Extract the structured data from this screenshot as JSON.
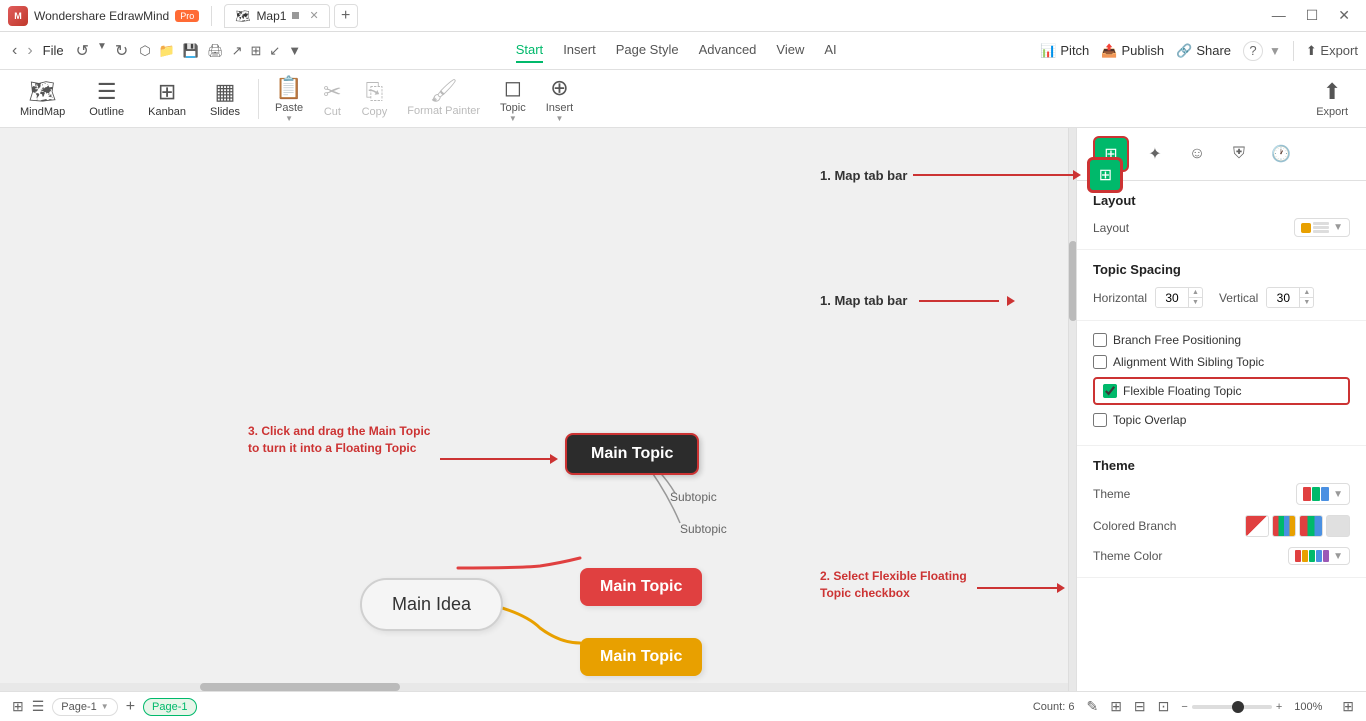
{
  "titlebar": {
    "app_name": "Wondershare EdrawMind",
    "pro_label": "Pro",
    "tab_name": "Map1",
    "tab_icon": "🗺",
    "add_tab": "+",
    "minimize": "—",
    "maximize": "☐",
    "close": "✕"
  },
  "menubar": {
    "back": "‹",
    "forward": "›",
    "file": "File",
    "undo": "↺",
    "redo": "↻",
    "toolbar_icons": [
      "□",
      "□",
      "⊞",
      "🖨",
      "↗",
      "◫",
      "↙"
    ],
    "tabs": [
      {
        "label": "Start",
        "active": true
      },
      {
        "label": "Insert",
        "active": false
      },
      {
        "label": "Page Style",
        "active": false
      },
      {
        "label": "Advanced",
        "active": false
      },
      {
        "label": "View",
        "active": false
      },
      {
        "label": "AI",
        "active": false
      }
    ],
    "pitch": "Pitch",
    "publish": "Publish",
    "share": "Share",
    "help": "?",
    "export": "Export"
  },
  "toolbar": {
    "mindmap": "MindMap",
    "outline": "Outline",
    "kanban": "Kanban",
    "slides": "Slides",
    "paste": "Paste",
    "cut": "Cut",
    "copy": "Copy",
    "format_painter": "Format Painter",
    "topic": "Topic",
    "insert": "Insert"
  },
  "canvas": {
    "annotation1": "3. Click and drag the Main Topic to turn it into a Floating Topic",
    "annotation2": "2. Select Flexible Floating Topic checkbox",
    "map_tab_label": "1. Map tab bar",
    "main_idea": "Main Idea",
    "main_topic_dark": "Main Topic",
    "main_topic_red": "Main Topic",
    "main_topic_orange": "Main Topic",
    "subtopic1": "Subtopic",
    "subtopic2": "Subtopic"
  },
  "right_panel": {
    "tabs": [
      {
        "name": "layout",
        "icon": "⊞",
        "active": true
      },
      {
        "name": "sparkle",
        "icon": "✦",
        "active": false
      },
      {
        "name": "emoji",
        "icon": "☺",
        "active": false
      },
      {
        "name": "shield",
        "icon": "⛨",
        "active": false
      },
      {
        "name": "clock",
        "icon": "🕐",
        "active": false
      }
    ],
    "layout_section": {
      "title": "Layout",
      "layout_label": "Layout",
      "layout_value": "grid"
    },
    "spacing_section": {
      "title": "Topic Spacing",
      "horizontal_label": "Horizontal",
      "horizontal_value": "30",
      "vertical_label": "Vertical",
      "vertical_value": "30"
    },
    "checkboxes": {
      "branch_free": {
        "label": "Branch Free Positioning",
        "checked": false
      },
      "alignment": {
        "label": "Alignment With Sibling Topic",
        "checked": false
      },
      "flexible_floating": {
        "label": "Flexible Floating Topic",
        "checked": true
      },
      "topic_overlap": {
        "label": "Topic Overlap",
        "checked": false
      }
    },
    "theme_section": {
      "title": "Theme",
      "theme_label": "Theme"
    },
    "colored_branch_label": "Colored Branch",
    "theme_color_label": "Theme Color"
  },
  "statusbar": {
    "icons_left": [
      "⊞",
      "☰"
    ],
    "page_tab1": "Page-1",
    "page_tab2": "Page-1",
    "add_page": "+",
    "count": "Count: 6",
    "zoom": "100%",
    "fit_icon": "⊞"
  }
}
